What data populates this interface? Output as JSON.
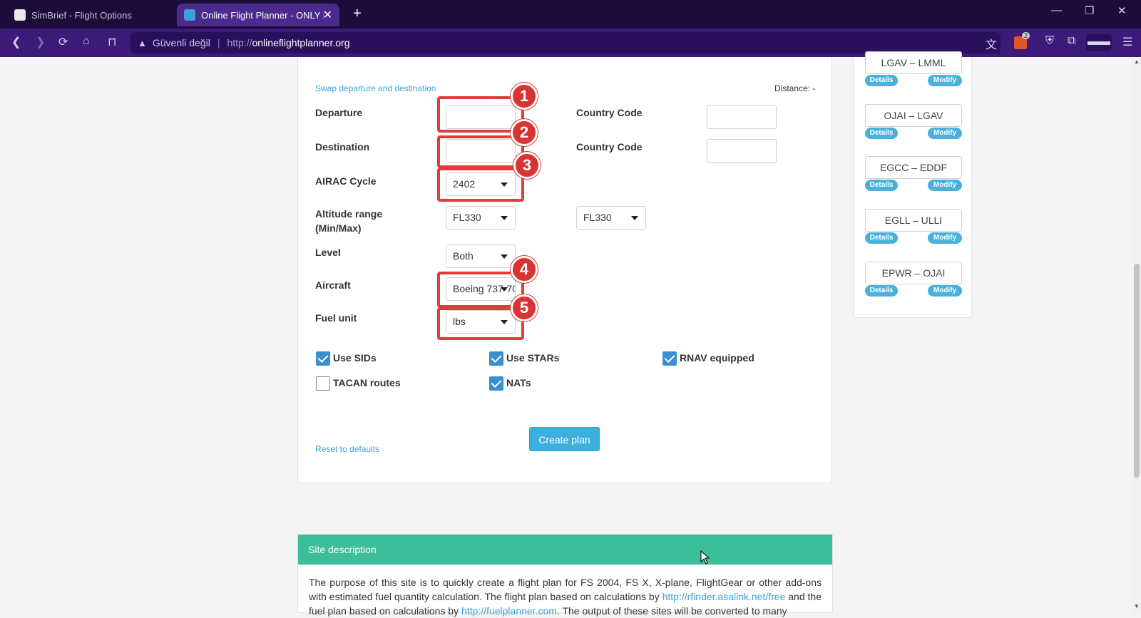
{
  "browser": {
    "tabs": [
      {
        "title": "SimBrief - Flight Options",
        "active": false
      },
      {
        "title": "Online Flight Planner - ONLY FO",
        "active": true
      }
    ],
    "security_label": "Güvenli değil",
    "url_protocol": "http://",
    "url_host": "onlineflightplanner.org",
    "brave_badge": "2"
  },
  "form": {
    "swap_link": "Swap departure and destination",
    "distance": "Distance: -",
    "departure_label": "Departure",
    "destination_label": "Destination",
    "country_code_label": "Country Code",
    "airac_label": "AIRAC Cycle",
    "airac_value": "2402",
    "altitude_label_1": "Altitude range",
    "altitude_label_2": "(Min/Max)",
    "altitude_min": "FL330",
    "altitude_max": "FL330",
    "level_label": "Level",
    "level_value": "Both",
    "aircraft_label": "Aircraft",
    "aircraft_value": "Boeing 737-70",
    "fuel_label": "Fuel unit",
    "fuel_value": "lbs",
    "options": {
      "use_sids": "Use SIDs",
      "use_stars": "Use STARs",
      "rnav": "RNAV equipped",
      "tacan": "TACAN routes",
      "nats": "NATs"
    },
    "create_button": "Create plan",
    "reset_link": "Reset to defaults"
  },
  "annotations": [
    "1",
    "2",
    "3",
    "4",
    "5"
  ],
  "recent_routes": [
    {
      "route": "LGAV – LMML",
      "details": "Details",
      "modify": "Modify"
    },
    {
      "route": "OJAI – LGAV",
      "details": "Details",
      "modify": "Modify"
    },
    {
      "route": "EGCC – EDDF",
      "details": "Details",
      "modify": "Modify"
    },
    {
      "route": "EGLL – ULLI",
      "details": "Details",
      "modify": "Modify"
    },
    {
      "route": "EPWR – OJAI",
      "details": "Details",
      "modify": "Modify"
    }
  ],
  "site_description": {
    "heading": "Site description",
    "text_1": "The purpose of this site is to quickly create a flight plan for FS 2004, FS X, X-plane, FlightGear or other add-ons with estimated fuel quantity calculation. The flight plan based on calculations by ",
    "link_1": "http://rfinder.asalink.net/free",
    "text_2": " and the fuel plan based on calculations by ",
    "link_2": "http://fuelplanner.com",
    "text_3": ". The output of these sites will be converted to many"
  },
  "colors": {
    "titlebar": "#1c0c3a",
    "toolbar": "#3c1a78",
    "highlight": "#e03c3c",
    "accent": "#3cb0dc",
    "description_header": "#3cbf98"
  }
}
